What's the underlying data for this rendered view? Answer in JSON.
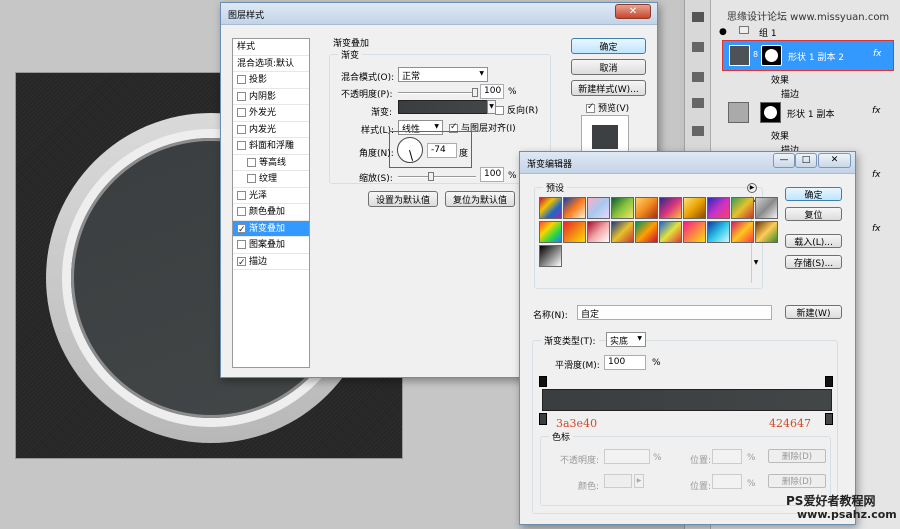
{
  "watermark_top": "思缘设计论坛 www.missyuan.com",
  "watermark_bottom_1": "PS爱好者教程网",
  "watermark_bottom_2": "www.psahz.com",
  "layers": {
    "group": "组 1",
    "layer1": "形状 1 副本 2",
    "effects": "效果",
    "stroke": "描边",
    "layer2": "形状 1 副本",
    "effects2": "效果",
    "stroke2": "描边",
    "fx": "fx"
  },
  "layer_style": {
    "title": "图层样式",
    "close": "✕",
    "styles_header": "样式",
    "blend_options": "混合选项:默认",
    "styles": [
      {
        "label": "投影",
        "checked": false
      },
      {
        "label": "内阴影",
        "checked": false
      },
      {
        "label": "外发光",
        "checked": false
      },
      {
        "label": "内发光",
        "checked": false
      },
      {
        "label": "斜面和浮雕",
        "checked": false
      },
      {
        "label": "等高线",
        "checked": false
      },
      {
        "label": "纹理",
        "checked": false
      },
      {
        "label": "光泽",
        "checked": false
      },
      {
        "label": "颜色叠加",
        "checked": false
      },
      {
        "label": "渐变叠加",
        "checked": true
      },
      {
        "label": "图案叠加",
        "checked": false
      },
      {
        "label": "描边",
        "checked": true
      }
    ],
    "section_title": "渐变叠加",
    "group_title": "渐变",
    "blend_mode_label": "混合模式(O):",
    "blend_mode_value": "正常",
    "opacity_label": "不透明度(P):",
    "opacity_value": "100",
    "opacity_fraction": 1.0,
    "percent": "%",
    "gradient_label": "渐变:",
    "reverse_label": "反向(R)",
    "style_label": "样式(L):",
    "style_value": "线性",
    "align_label": "与图层对齐(I)",
    "angle_label": "角度(N):",
    "angle_value": "-74",
    "angle_unit": "度",
    "scale_label": "缩放(S):",
    "scale_value": "100",
    "scale_fraction": 0.4,
    "set_default": "设置为默认值",
    "reset_default": "复位为默认值",
    "ok": "确定",
    "cancel": "取消",
    "new_style": "新建样式(W)...",
    "preview_label": "预览(V)"
  },
  "gradient_editor": {
    "title": "渐变编辑器",
    "presets_label": "预设",
    "ok": "确定",
    "reset": "复位",
    "load": "载入(L)...",
    "save": "存储(S)...",
    "name_label": "名称(N):",
    "name_value": "自定",
    "new_button": "新建(W)",
    "type_label": "渐变类型(T):",
    "type_value": "实底",
    "smooth_label": "平滑度(M):",
    "smooth_value": "100",
    "percent": "%",
    "color_left": "3a3e40",
    "color_right": "424647",
    "stops_title": "色标",
    "opacity_label": "不透明度:",
    "location_label": "位置:",
    "delete_label": "删除(D)",
    "color_label": "颜色:",
    "presets": [
      "linear-gradient(135deg,#c2183c,#f2c200,#1d66c9,#9c2ea7)",
      "linear-gradient(135deg,#1f3fa8,#ff7a1a,#fdf3d4)",
      "linear-gradient(135deg,#f7b0c6,#a7c8ef,#e9d7ff)",
      "linear-gradient(135deg,#0d5e2f,#89c23e,#f7e463)",
      "linear-gradient(135deg,#ffd36b,#f08a1f,#a82d12)",
      "linear-gradient(135deg,#302a89,#d6327f,#ffbd3a)",
      "linear-gradient(135deg,#ffe17a,#e9a100,#8a4b00)",
      "linear-gradient(135deg,#2a2ab5,#c733c7,#ff3c6e)",
      "linear-gradient(135deg,#3a9e5e,#e6c12b,#c7382f)",
      "linear-gradient(135deg,#d0d0d0,#8a8a8a,#f2f2f2)",
      "linear-gradient(135deg,#ff4b2b,#ffd400,#2bd93f,#1d7cff)",
      "linear-gradient(135deg,#e62a2a,#ffde00)",
      "linear-gradient(135deg,#a80c2e,#f2a6a6,#ffffff)",
      "linear-gradient(135deg,#203a84,#e6c12b,#cb3a2f)",
      "linear-gradient(135deg,#00915f,#ff9e00,#c8102e)",
      "linear-gradient(135deg,#1c65d9,#e2e33c,#e63434)",
      "linear-gradient(135deg,#f51f86,#ffe00a)",
      "linear-gradient(135deg,#1238a3,#2ec4e8,#d4f7ff)",
      "linear-gradient(135deg,#d21f6b,#ffc51f,#ff3c3c)",
      "linear-gradient(135deg,#6a3a0f,#ffcc55,#3a8a2a)",
      "linear-gradient(135deg,#000000,#ffffff)"
    ]
  },
  "colors": {
    "gradient_left": "#3a3e40",
    "gradient_right": "#424647",
    "stop_label": "#d04a2a",
    "selection": "#3399ff"
  }
}
